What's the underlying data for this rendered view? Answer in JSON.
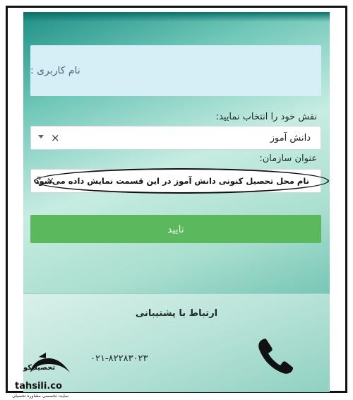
{
  "form": {
    "username_placeholder": "نام کاربری :",
    "role_label": "نقش خود را انتخاب نمایید:",
    "role_value": "دانش آموز",
    "org_label": "عنوان سازمان:",
    "org_value": "نام محل تحصیل کنونی دانش آموز در این قسمت نمایش داده می‌شود",
    "submit_label": "تایید",
    "clear_symbol": "×"
  },
  "support": {
    "title": "ارتباط با پشتیبانی",
    "phone": "۰۲۱-۸۲۲۸۳۰۲۳",
    "icon": "phone-icon"
  },
  "watermark": {
    "name_fa": "تحصیلیکو",
    "domain": "tahsili.co",
    "tagline": "سایت تخصصی مشاوره تحصیلی"
  },
  "colors": {
    "submit_green": "#5cb85c",
    "input_blue": "#d6eef6",
    "bg_teal": "#6fc7b8"
  }
}
